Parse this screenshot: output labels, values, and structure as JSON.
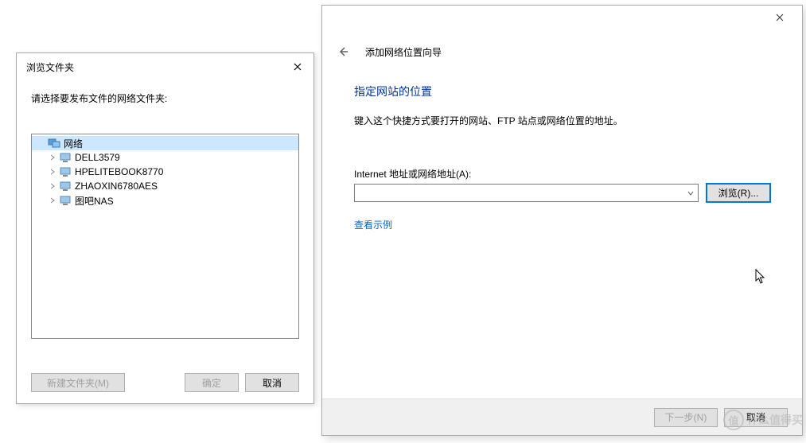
{
  "browse": {
    "title": "浏览文件夹",
    "instruction": "请选择要发布文件的网络文件夹:",
    "root_label": "网络",
    "items": [
      {
        "label": "DELL3579"
      },
      {
        "label": "HPELITEBOOK8770"
      },
      {
        "label": "ZHAOXIN6780AES"
      },
      {
        "label": "图吧NAS"
      }
    ],
    "buttons": {
      "new_folder": "新建文件夹(M)",
      "ok": "确定",
      "cancel": "取消"
    }
  },
  "wizard": {
    "title": "添加网络位置向导",
    "heading": "指定网站的位置",
    "description": "键入这个快捷方式要打开的网站、FTP 站点或网络位置的地址。",
    "field_label": "Internet 地址或网络地址(A):",
    "address_value": "",
    "browse_btn": "浏览(R)...",
    "example_link": "查看示例",
    "footer": {
      "next": "下一步(N)",
      "cancel": "取消"
    }
  },
  "watermark": {
    "icon_text": "值",
    "text": "什么值得买"
  }
}
